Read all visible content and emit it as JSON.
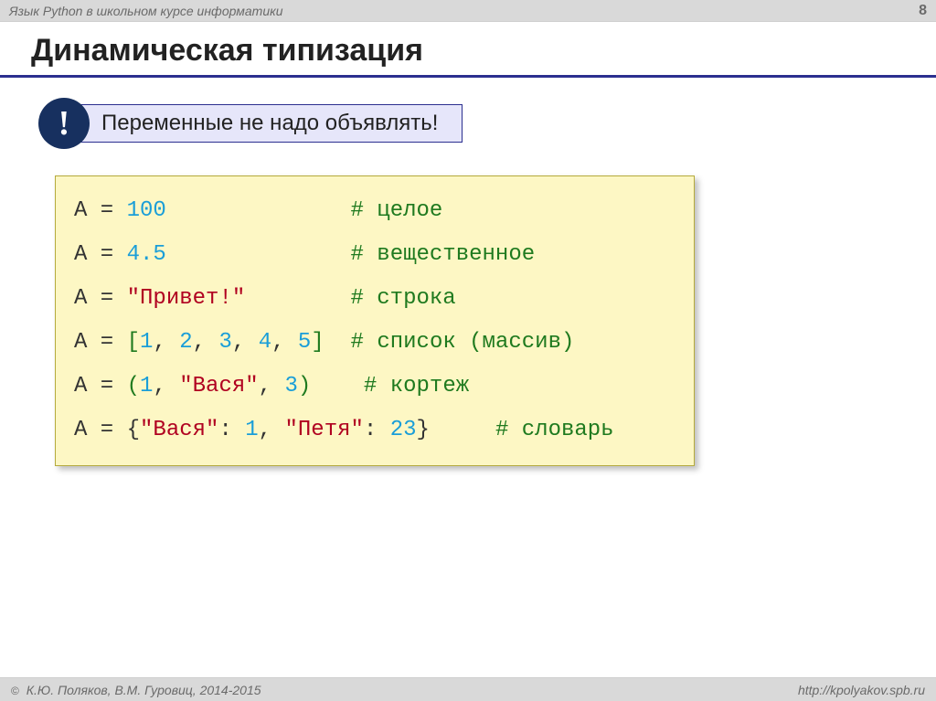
{
  "topbar": {
    "course_title": "Язык Python в школьном курсе информатики",
    "page_number": "8"
  },
  "heading": "Динамическая типизация",
  "callout": {
    "exclamation": "!",
    "text": "Переменные не надо объявлять!"
  },
  "code": {
    "lines": [
      {
        "var": "A",
        "op": " = ",
        "val_type": "num",
        "val": "100",
        "pad": "              ",
        "comment": "# целое"
      },
      {
        "var": "A",
        "op": " = ",
        "val_type": "num",
        "val": "4.5",
        "pad": "              ",
        "comment": "# вещественное"
      },
      {
        "var": "A",
        "op": " = ",
        "val_type": "str",
        "val": "\"Привет!\"",
        "pad": "        ",
        "comment": "# строка"
      },
      {
        "var": "A",
        "op": " = ",
        "val_type": "list",
        "lb": "[",
        "items": [
          {
            "t": "num",
            "v": "1"
          },
          {
            "t": "num",
            "v": "2"
          },
          {
            "t": "num",
            "v": "3"
          },
          {
            "t": "num",
            "v": "4"
          },
          {
            "t": "num",
            "v": "5"
          }
        ],
        "rb": "]",
        "pad": "  ",
        "comment": "# список (массив)"
      },
      {
        "var": "A",
        "op": " = ",
        "val_type": "tuple",
        "lb": "(",
        "items": [
          {
            "t": "num",
            "v": "1"
          },
          {
            "t": "str",
            "v": "\"Вася\""
          },
          {
            "t": "num",
            "v": "3"
          }
        ],
        "rb": ")",
        "pad": "    ",
        "comment": "# кортеж"
      },
      {
        "var": "A",
        "op": " = ",
        "val_type": "dict",
        "lb": "{",
        "pairs": [
          {
            "k": "\"Вася\"",
            "v": "1"
          },
          {
            "k": "\"Петя\"",
            "v": "23"
          }
        ],
        "rb": "}",
        "pad": "     ",
        "comment": "# словарь"
      }
    ]
  },
  "footer": {
    "copyright_symbol": "©",
    "authors": " К.Ю. Поляков, В.М. Гуровиц, 2014-2015",
    "url": "http://kpolyakov.spb.ru"
  }
}
